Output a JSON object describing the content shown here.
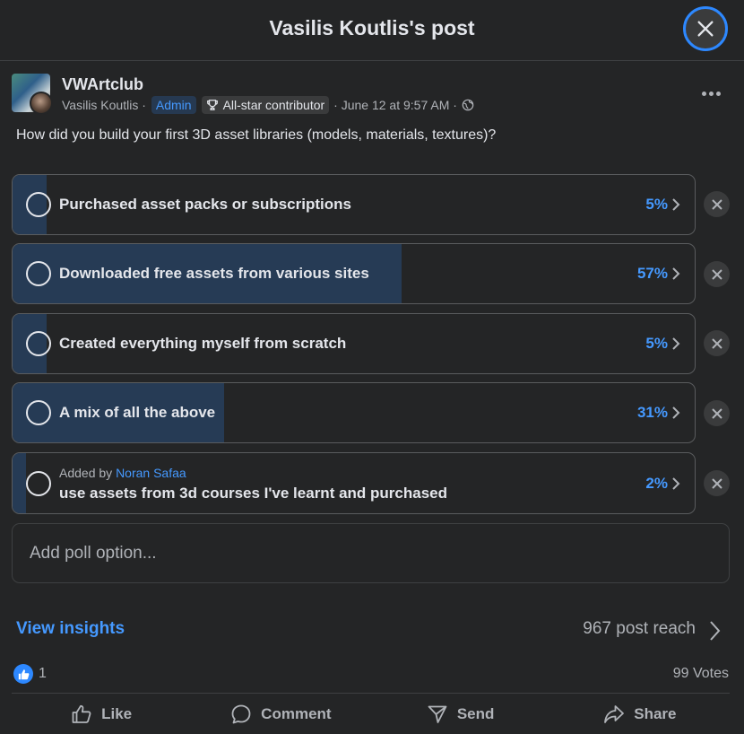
{
  "dialog": {
    "title": "Vasilis Koutlis's post"
  },
  "post": {
    "group_name": "VWArtclub",
    "author": "Vasilis Koutlis ·",
    "admin_badge": "Admin",
    "star_badge": "All-star contributor",
    "date": "· June 12 at 9:57 AM ·",
    "question": "How did you build your first 3D asset libraries (models, materials, textures)?"
  },
  "poll": {
    "options": [
      {
        "label": "Purchased asset packs or subscriptions",
        "percent": "5%",
        "fill_fraction": 0.05
      },
      {
        "label": "Downloaded free assets from various sites",
        "percent": "57%",
        "fill_fraction": 0.57
      },
      {
        "label": "Created everything myself from scratch",
        "percent": "5%",
        "fill_fraction": 0.05
      },
      {
        "label": "A mix of all the above",
        "percent": "31%",
        "fill_fraction": 0.31
      },
      {
        "added_by_prefix": "Added by",
        "added_by_name": "Noran Safaa",
        "label": "use assets from 3d courses I've learnt and purchased",
        "percent": "2%",
        "fill_fraction": 0.02
      }
    ],
    "add_placeholder": "Add poll option..."
  },
  "insights": {
    "link": "View insights",
    "reach": "967 post reach"
  },
  "reactions": {
    "like_count": "1",
    "votes": "99 Votes"
  },
  "actions": {
    "like": "Like",
    "comment": "Comment",
    "send": "Send",
    "share": "Share"
  },
  "colors": {
    "accent": "#4599ff",
    "bar_fill": "#263b55",
    "background": "#242526",
    "like_blue": "#2d88ff"
  },
  "icons": {
    "close": "close-icon",
    "more": "more-icon",
    "trophy": "trophy-icon",
    "globe": "globe-icon",
    "chevron": "chevron-right-icon",
    "like": "thumbs-up-icon",
    "comment": "comment-icon",
    "send": "send-icon",
    "share": "share-icon"
  }
}
